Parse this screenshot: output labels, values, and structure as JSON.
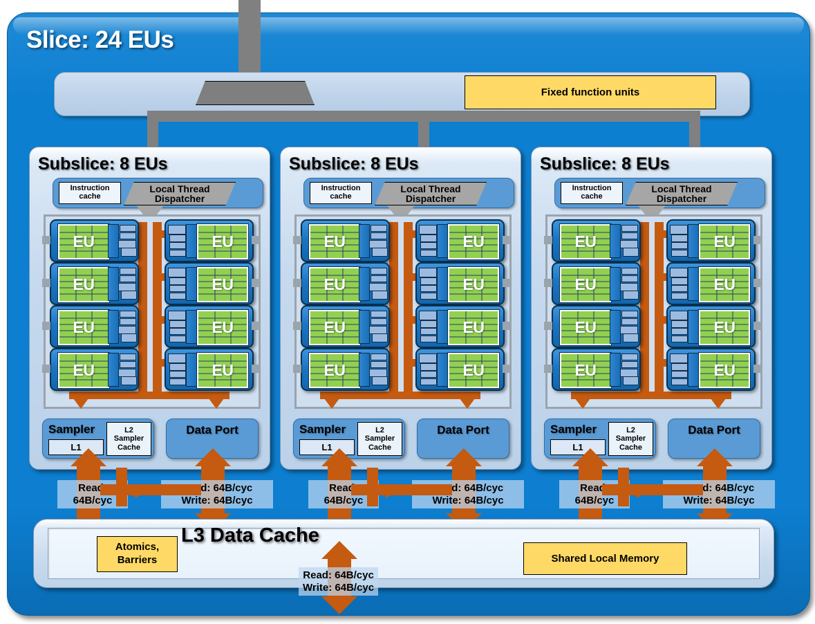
{
  "slice": {
    "title": "Slice: 24 EUs",
    "fixed_function_units": "Fixed function units",
    "thread_dispatch_shape": "global-thread-dispatcher"
  },
  "colors": {
    "slice_blue": "#0d7fd1",
    "panel_blue": "#c6d9ee",
    "eu_green": "#92d050",
    "eu_body_blue": "#1b75c4",
    "accent_orange": "#c55a11",
    "yellow_box": "#ffd966",
    "gray_pipe": "#808080",
    "dispatcher_gray": "#a6a6a6"
  },
  "subslices": [
    {
      "title": "Subslice: 8 EUs",
      "instruction_cache": "Instruction cache",
      "instruction_cache_line1": "Instruction",
      "instruction_cache_line2": "cache",
      "local_thread_dispatcher_line1": "Local Thread",
      "local_thread_dispatcher_line2": "Dispatcher",
      "eu_count": 8,
      "eu_label": "EU",
      "sampler": "Sampler",
      "sampler_l1": "L1",
      "l2_sampler_cache_line1": "L2",
      "l2_sampler_cache_line2": "Sampler",
      "l2_sampler_cache_line3": "Cache",
      "data_port": "Data Port",
      "sampler_bw_line1": "Read:",
      "sampler_bw_line2": "64B/cyc",
      "dataport_bw_line1": "Read: 64B/cyc",
      "dataport_bw_line2": "Write: 64B/cyc"
    },
    {
      "title": "Subslice: 8 EUs",
      "instruction_cache": "Instruction cache",
      "instruction_cache_line1": "Instruction",
      "instruction_cache_line2": "cache",
      "local_thread_dispatcher_line1": "Local Thread",
      "local_thread_dispatcher_line2": "Dispatcher",
      "eu_count": 8,
      "eu_label": "EU",
      "sampler": "Sampler",
      "sampler_l1": "L1",
      "l2_sampler_cache_line1": "L2",
      "l2_sampler_cache_line2": "Sampler",
      "l2_sampler_cache_line3": "Cache",
      "data_port": "Data Port",
      "sampler_bw_line1": "Read:",
      "sampler_bw_line2": "64B/cyc",
      "dataport_bw_line1": "Read: 64B/cyc",
      "dataport_bw_line2": "Write: 64B/cyc"
    },
    {
      "title": "Subslice: 8 EUs",
      "instruction_cache": "Instruction cache",
      "instruction_cache_line1": "Instruction",
      "instruction_cache_line2": "cache",
      "local_thread_dispatcher_line1": "Local Thread",
      "local_thread_dispatcher_line2": "Dispatcher",
      "eu_count": 8,
      "eu_label": "EU",
      "sampler": "Sampler",
      "sampler_l1": "L1",
      "l2_sampler_cache_line1": "L2",
      "l2_sampler_cache_line2": "Sampler",
      "l2_sampler_cache_line3": "Cache",
      "data_port": "Data Port",
      "sampler_bw_line1": "Read:",
      "sampler_bw_line2": "64B/cyc",
      "dataport_bw_line1": "Read: 64B/cyc",
      "dataport_bw_line2": "Write: 64B/cyc"
    }
  ],
  "l3": {
    "title": "L3 Data Cache",
    "atomics_line1": "Atomics,",
    "atomics_line2": "Barriers",
    "shared_local_memory": "Shared Local Memory",
    "bottom_bw_line1": "Read: 64B/cyc",
    "bottom_bw_line2": "Write: 64B/cyc"
  }
}
